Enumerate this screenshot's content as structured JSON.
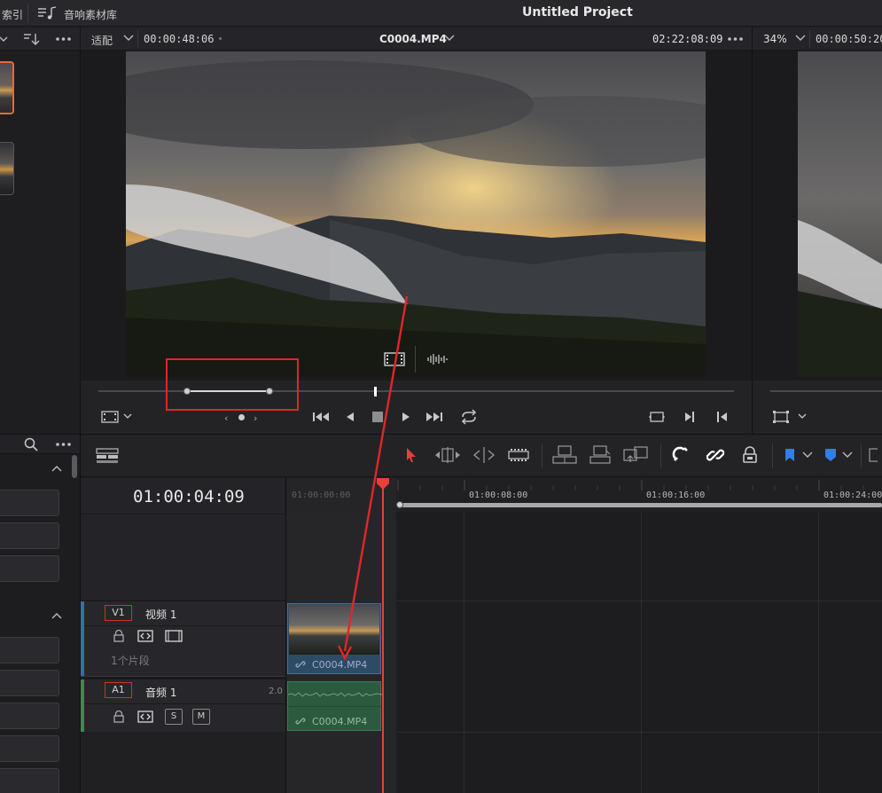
{
  "topbar": {
    "left_fragment": "索引",
    "sound_library": "音响素材库",
    "project_title": "Untitled Project"
  },
  "source_viewer": {
    "fit_label": "适配",
    "timecode_left": "00:00:48:06",
    "clip_name": "C0004.MP4",
    "timecode_right": "02:22:08:09"
  },
  "timeline_viewer": {
    "zoom": "34%",
    "timecode": "00:00:50:20"
  },
  "timeline": {
    "current_timecode": "01:00:04:09",
    "ruler": [
      "01:00:00:00",
      "01:00:08:00",
      "01:00:16:00",
      "01:00:24:00"
    ]
  },
  "tracks": {
    "video": {
      "tag": "V1",
      "name": "视频 1",
      "clip_count": "1个片段",
      "clip_name": "C0004.MP4"
    },
    "audio": {
      "tag": "A1",
      "name": "音频 1",
      "level": "2.0",
      "solo": "S",
      "mute": "M",
      "clip_name": "C0004.MP4"
    }
  },
  "colors": {
    "playhead": "#e5403a",
    "annotation": "#e0262a",
    "video_clip": "#2e4b66",
    "audio_clip": "#2b5a3e",
    "accent_blue": "#2f7fe6"
  },
  "icons": {
    "sound_library": "music-list-icon",
    "sort": "sort-icon",
    "more": "ellipsis-icon",
    "search": "search-icon",
    "select": "pointer-icon",
    "snap": "magnet-icon",
    "link": "link-icon",
    "lock": "lock-icon",
    "flag": "flag-icon",
    "marker": "marker-icon"
  }
}
